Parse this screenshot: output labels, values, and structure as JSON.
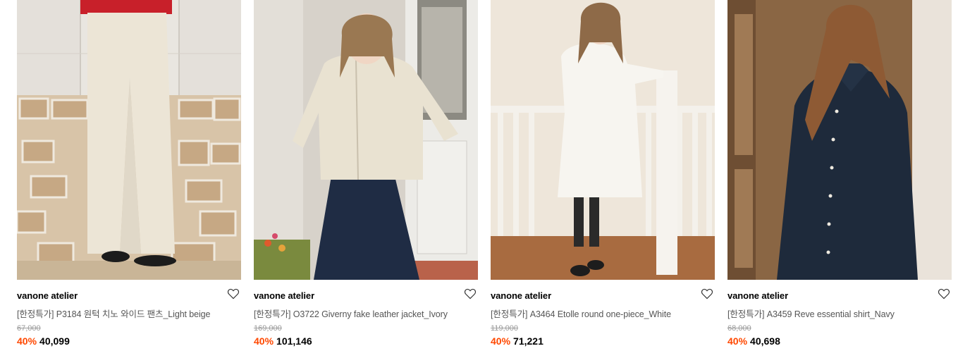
{
  "products": [
    {
      "brand": "vanone atelier",
      "title": "[한정특가] P3184 원턱 치노 와이드 팬츠_Light beige",
      "original_price": "67,000",
      "discount": "40%",
      "sale_price": "40,099",
      "image_icon": "product-photo-wide-pants",
      "colors": {
        "bg": "#ece7df",
        "garment": "#e9e3d6"
      }
    },
    {
      "brand": "vanone atelier",
      "title": "[한정특가] O3722 Giverny fake leather jacket_Ivory",
      "original_price": "169,000",
      "discount": "40%",
      "sale_price": "101,146",
      "image_icon": "product-photo-jacket",
      "colors": {
        "bg": "#d9d4cc",
        "garment": "#e6dfcf"
      }
    },
    {
      "brand": "vanone atelier",
      "title": "[한정특가] A3464 Etolle round one-piece_White",
      "original_price": "119,000",
      "discount": "40%",
      "sale_price": "71,221",
      "image_icon": "product-photo-onepiece",
      "colors": {
        "bg": "#eee7dc",
        "garment": "#f6f4ef"
      }
    },
    {
      "brand": "vanone atelier",
      "title": "[한정특가] A3459 Reve essential shirt_Navy",
      "original_price": "68,000",
      "discount": "40%",
      "sale_price": "40,698",
      "image_icon": "product-photo-shirt",
      "colors": {
        "bg": "#8b6a4a",
        "garment": "#1f2b3c"
      }
    }
  ],
  "accent_color": "#ff4800",
  "wishlist_icon": "heart-outline-icon"
}
